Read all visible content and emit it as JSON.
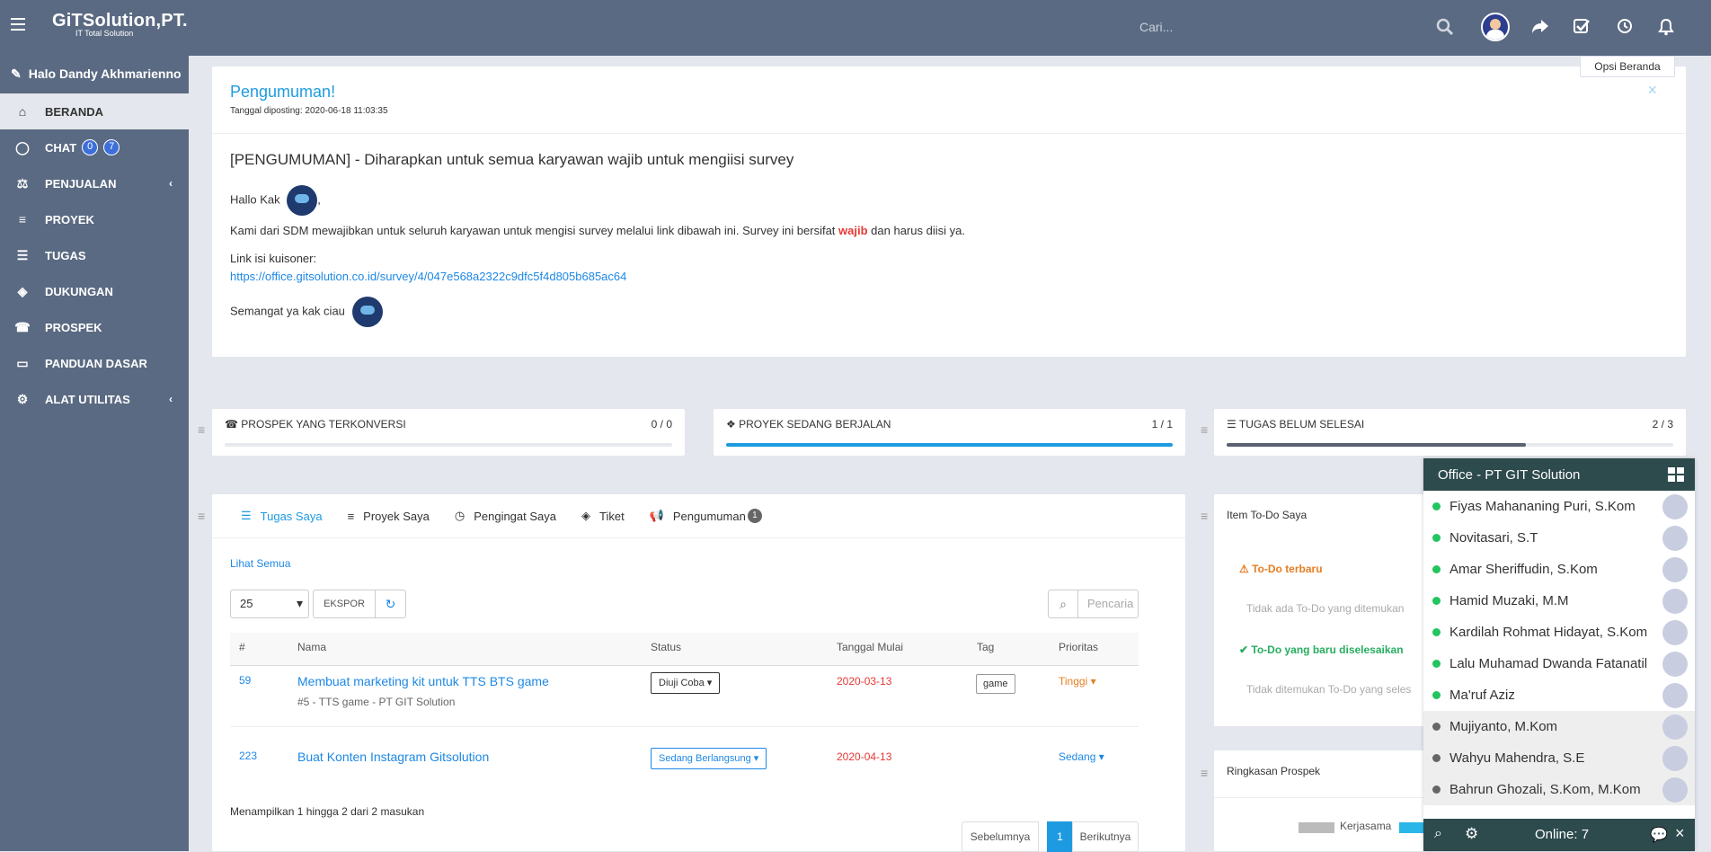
{
  "app": {
    "logo_text": "GiTSolution,PT.",
    "logo_sub": "IT Total Solution",
    "search_placeholder": "Cari...",
    "greeting": "Halo Dandy Akhmarienno",
    "options_label": "Opsi Beranda"
  },
  "sidebar": {
    "items": [
      {
        "label": "BERANDA",
        "icon": "home-icon"
      },
      {
        "label": "CHAT",
        "icon": "chat-icon",
        "badge1": "0",
        "badge2": "7"
      },
      {
        "label": "PENJUALAN",
        "icon": "balance-icon"
      },
      {
        "label": "PROYEK",
        "icon": "bars-icon"
      },
      {
        "label": "TUGAS",
        "icon": "tasks-icon"
      },
      {
        "label": "DUKUNGAN",
        "icon": "ticket-icon"
      },
      {
        "label": "PROSPEK",
        "icon": "tty-icon"
      },
      {
        "label": "PANDUAN DASAR",
        "icon": "folder-open-icon"
      },
      {
        "label": "ALAT UTILITAS",
        "icon": "cogs-icon"
      }
    ]
  },
  "announcement": {
    "title": "Pengumuman!",
    "posted": "Tanggal diposting: 2020-06-18 11:03:35",
    "heading": "[PENGUMUMAN] - Diharapkan untuk semua karyawan wajib untuk mengiisi survey",
    "greeting": "Hallo Kak",
    "body_before": "Kami dari SDM mewajibkan untuk seluruh karyawan untuk mengisi survey melalui link dibawah ini. Survey ini bersifat ",
    "body_bold": "wajib",
    "body_after": " dan harus diisi ya.",
    "link_label": "Link isi kuisoner:",
    "link": "https://office.gitsolution.co.id/survey/4/047e568a2322c9dfc5f4d805b685ac64",
    "closing": "Semangat ya kak ciau"
  },
  "stats": [
    {
      "label": "PROSPEK YANG TERKONVERSI",
      "count": "0 / 0",
      "progress": 0
    },
    {
      "label": "PROYEK SEDANG BERJALAN",
      "count": "1 / 1",
      "progress": 1
    },
    {
      "label": "TUGAS BELUM SELESAI",
      "count": "2 / 3",
      "progress": 0.67
    }
  ],
  "tasks": {
    "tabs": [
      "Tugas Saya",
      "Proyek Saya",
      "Pengingat Saya",
      "Tiket",
      "Pengumuman"
    ],
    "announce_count": "1",
    "see_all": "Lihat Semua",
    "page_size": "25",
    "export_label": "EKSPOR",
    "search_placeholder": "Pencaria",
    "columns": [
      "#",
      "Nama",
      "Status",
      "Tanggal Mulai",
      "Tag",
      "Prioritas"
    ],
    "rows": [
      {
        "id": "59",
        "name": "Membuat marketing kit untuk TTS BTS game",
        "sub": "#5 - TTS game - PT GIT Solution",
        "status": "Diuji Coba",
        "date": "2020-03-13",
        "tag": "game",
        "priority": "Tinggi"
      },
      {
        "id": "223",
        "name": "Buat Konten Instagram Gitsolution",
        "sub": "",
        "status": "Sedang Berlangsung",
        "date": "2020-04-13",
        "tag": "",
        "priority": "Sedang"
      }
    ],
    "footer": "Menampilkan 1 hingga 2 dari 2 masukan",
    "prev": "Sebelumnya",
    "page": "1",
    "next": "Berikutnya"
  },
  "todo": {
    "title": "Item To-Do Saya",
    "latest_label": "To-Do terbaru",
    "latest_empty": "Tidak ada To-Do yang ditemukan",
    "done_label": "To-Do yang baru diselesaikan",
    "done_empty": "Tidak ditemukan To-Do yang seles"
  },
  "summary": {
    "title": "Ringkasan Prospek",
    "legend1": "Kerjasama"
  },
  "chat": {
    "title": "Office - PT GIT Solution",
    "online": "Online: 7",
    "users": [
      {
        "name": "Fiyas Mahananing Puri, S.Kom",
        "online": true
      },
      {
        "name": "Novitasari, S.T",
        "online": true
      },
      {
        "name": "Amar Sheriffudin, S.Kom",
        "online": true
      },
      {
        "name": "Hamid Muzaki, M.M",
        "online": true
      },
      {
        "name": "Kardilah Rohmat Hidayat, S.Kom",
        "online": true
      },
      {
        "name": "Lalu Muhamad Dwanda Fatanatil",
        "online": true
      },
      {
        "name": "Ma'ruf Aziz",
        "online": true
      },
      {
        "name": "Mujiyanto, M.Kom",
        "online": false
      },
      {
        "name": "Wahyu Mahendra, S.E",
        "online": false
      },
      {
        "name": "Bahrun Ghozali, S.Kom, M.Kom",
        "online": false
      }
    ]
  },
  "colors": {
    "accent": "#1e9be0",
    "sidebar": "#5a6a82",
    "online": "#22c55e",
    "offline": "#666666",
    "red": "#e53935",
    "orange": "#e67e22"
  }
}
